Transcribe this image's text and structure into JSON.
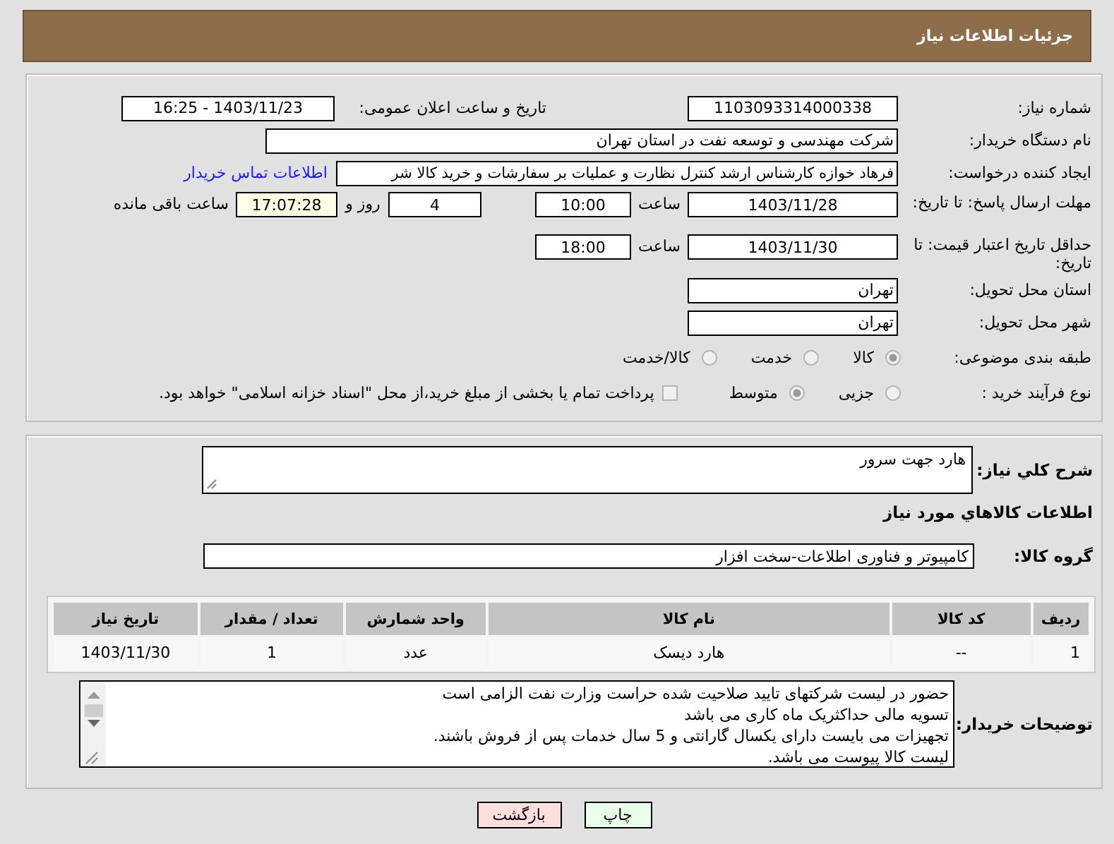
{
  "header": {
    "title": "جزئیات اطلاعات نیاز"
  },
  "need_number": {
    "label": "شماره نیاز:",
    "value": "1103093314000338"
  },
  "announce": {
    "label": "تاریخ و ساعت اعلان عمومی:",
    "value": "1403/11/23 - 16:25"
  },
  "buyer": {
    "label": "نام دستگاه خریدار:",
    "value": "شرکت مهندسی و توسعه نفت در استان تهران"
  },
  "requester": {
    "label": "ایجاد کننده درخواست:",
    "value": "فرهاد خوازه کارشناس ارشد کنترل نظارت و عملیات بر سفارشات و خرید کالا شر",
    "link": "اطلاعات تماس خریدار"
  },
  "deadline": {
    "label": "مهلت ارسال پاسخ: تا تاریخ:",
    "date": "1403/11/28",
    "time_label": "ساعت",
    "time": "10:00",
    "days": "4",
    "days_label": "روز و",
    "remaining": "17:07:28",
    "remaining_label": "ساعت باقی مانده"
  },
  "validity": {
    "label": "حداقل تاریخ اعتبار قیمت: تا تاریخ:",
    "date": "1403/11/30",
    "time_label": "ساعت",
    "time": "18:00"
  },
  "province": {
    "label": "استان محل تحویل:",
    "value": "تهران"
  },
  "city": {
    "label": "شهر محل تحویل:",
    "value": "تهران"
  },
  "category": {
    "label": "طبقه بندی موضوعی:",
    "options": [
      {
        "label": "کالا",
        "selected": true
      },
      {
        "label": "خدمت",
        "selected": false
      },
      {
        "label": "کالا/خدمت",
        "selected": false
      }
    ]
  },
  "process": {
    "label": "نوع فرآیند خرید :",
    "options": [
      {
        "label": "جزیی",
        "selected": false
      },
      {
        "label": "متوسط",
        "selected": true
      }
    ],
    "payment": {
      "label": "پرداخت تمام یا بخشی از مبلغ خرید،از محل \"اسناد خزانه اسلامی\" خواهد بود.",
      "checked": false
    }
  },
  "description": {
    "label": "شرح کلي نياز:",
    "value": "هارد جهت سرور"
  },
  "goods_heading": "اطلاعات کالاهاي مورد نياز",
  "goods_group": {
    "label": "گروه کالا:",
    "value": "کامپیوتر و فناوری اطلاعات-سخت افزار"
  },
  "table": {
    "columns": [
      "ردیف",
      "کد کالا",
      "نام کالا",
      "واحد شمارش",
      "تعداد / مقدار",
      "تاریخ نیاز"
    ],
    "rows": [
      [
        "1",
        "--",
        "هارد دیسک",
        "عدد",
        "1",
        "1403/11/30"
      ]
    ]
  },
  "buyer_notes": {
    "label": "توضیحات خریدار:",
    "lines": [
      "حضور در لیست شرکتهای تایید صلاحیت شده حراست وزارت نفت الزامی است",
      "تسویه مالی حداکثریک ماه کاری می باشد",
      "تجهیزات می بایست دارای یکسال گارانتی و 5 سال خدمات پس از فروش باشند.",
      "لیست کالا پیوست می باشد."
    ]
  },
  "buttons": [
    {
      "label": "چاپ",
      "kind": "print"
    },
    {
      "label": "بازگشت",
      "kind": "back"
    }
  ]
}
